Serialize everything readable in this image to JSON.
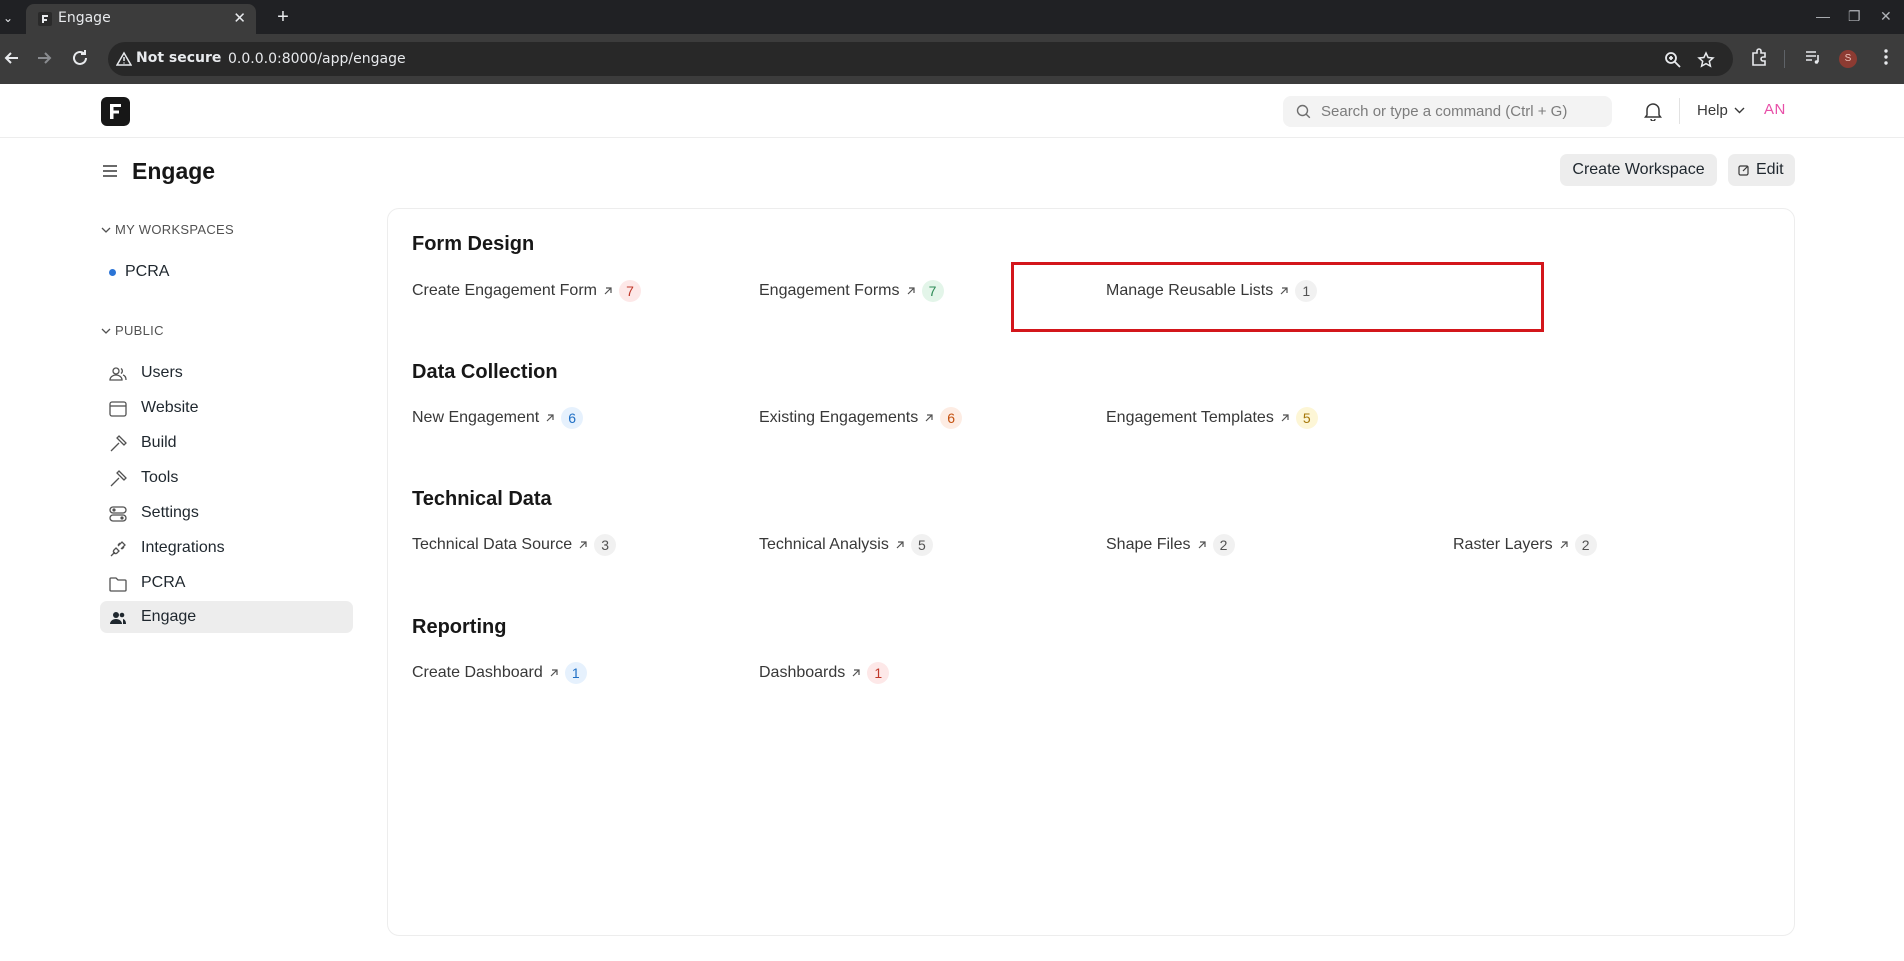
{
  "browser": {
    "tab_title": "Engage",
    "security_label": "Not secure",
    "url": "0.0.0.0:8000/app/engage",
    "profile_initial": "S"
  },
  "navbar": {
    "search_placeholder": "Search or type a command (Ctrl + G)",
    "help_label": "Help",
    "avatar_initials": "AN"
  },
  "page": {
    "title": "Engage",
    "create_workspace_label": "Create Workspace",
    "edit_label": "Edit"
  },
  "sidebar": {
    "my_workspaces_heading": "MY WORKSPACES",
    "my_workspaces": [
      {
        "label": "PCRA",
        "dot_color": "#2b74d6"
      }
    ],
    "public_heading": "PUBLIC",
    "public_items": [
      {
        "label": "Users",
        "icon": "users-icon"
      },
      {
        "label": "Website",
        "icon": "browser-window-icon"
      },
      {
        "label": "Build",
        "icon": "hammer-icon"
      },
      {
        "label": "Tools",
        "icon": "tools-icon"
      },
      {
        "label": "Settings",
        "icon": "toggles-icon"
      },
      {
        "label": "Integrations",
        "icon": "plug-icon"
      },
      {
        "label": "PCRA",
        "icon": "folder-icon"
      },
      {
        "label": "Engage",
        "icon": "users-filled-icon",
        "active": true
      }
    ]
  },
  "groups": [
    {
      "title": "Form Design",
      "links": [
        {
          "label": "Create Engagement Form",
          "count": "7",
          "badge_bg": "#fde8e8",
          "badge_fg": "#c0392b"
        },
        {
          "label": "Engagement Forms",
          "count": "7",
          "badge_bg": "#e3f5e9",
          "badge_fg": "#2e8b57"
        },
        {
          "label": "Manage Reusable Lists",
          "count": "1",
          "badge_bg": "#f1f1f1",
          "badge_fg": "#525252"
        }
      ]
    },
    {
      "title": "Data Collection",
      "links": [
        {
          "label": "New Engagement",
          "count": "6",
          "badge_bg": "#e6f1fd",
          "badge_fg": "#1f6fc5"
        },
        {
          "label": "Existing Engagements",
          "count": "6",
          "badge_bg": "#fdece3",
          "badge_fg": "#c4510f"
        },
        {
          "label": "Engagement Templates",
          "count": "5",
          "badge_bg": "#fdf6d6",
          "badge_fg": "#a6780a"
        }
      ]
    },
    {
      "title": "Technical Data",
      "links": [
        {
          "label": "Technical Data Source",
          "count": "3",
          "badge_bg": "#f1f1f1",
          "badge_fg": "#525252"
        },
        {
          "label": "Technical Analysis",
          "count": "5",
          "badge_bg": "#f1f1f1",
          "badge_fg": "#525252"
        },
        {
          "label": "Shape Files",
          "count": "2",
          "badge_bg": "#f1f1f1",
          "badge_fg": "#525252"
        },
        {
          "label": "Raster Layers",
          "count": "2",
          "badge_bg": "#f1f1f1",
          "badge_fg": "#525252"
        }
      ]
    },
    {
      "title": "Reporting",
      "links": [
        {
          "label": "Create Dashboard",
          "count": "1",
          "badge_bg": "#e6f1fd",
          "badge_fg": "#1f6fc5"
        },
        {
          "label": "Dashboards",
          "count": "1",
          "badge_bg": "#fde8e8",
          "badge_fg": "#c0392b"
        }
      ]
    }
  ],
  "colors": {
    "highlight_border": "#d3161b",
    "avatar_text": "#e84fa8"
  }
}
